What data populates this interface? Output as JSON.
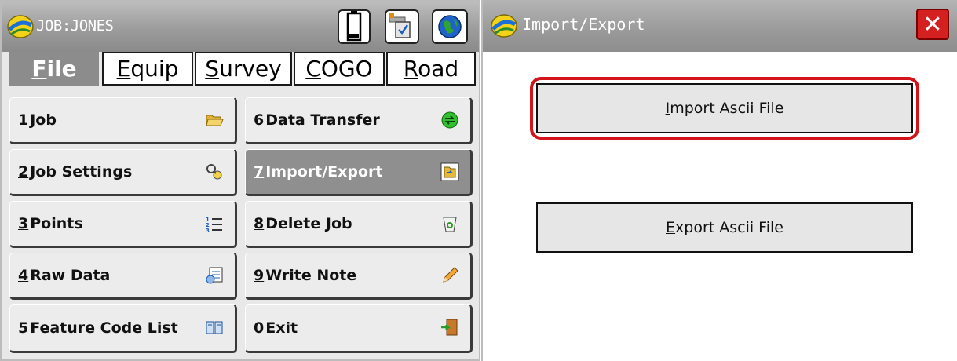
{
  "left_window": {
    "title": "JOB:JONES",
    "tabs": [
      {
        "key": "F",
        "rest": "ile",
        "active": true
      },
      {
        "key": "E",
        "rest": "quip",
        "active": false
      },
      {
        "key": "S",
        "rest": "urvey",
        "active": false
      },
      {
        "key": "C",
        "rest": "OGO",
        "active": false
      },
      {
        "key": "R",
        "rest": "oad",
        "active": false
      }
    ],
    "menu": [
      {
        "key": "1",
        "label": "Job",
        "icon": "folder-open-icon"
      },
      {
        "key": "2",
        "label": "Job Settings",
        "icon": "settings-search-icon"
      },
      {
        "key": "3",
        "label": "Points",
        "icon": "numbered-list-icon"
      },
      {
        "key": "4",
        "label": "Raw Data",
        "icon": "raw-data-icon"
      },
      {
        "key": "5",
        "label": "Feature Code List",
        "icon": "book-icon"
      },
      {
        "key": "6",
        "label": "Data Transfer",
        "icon": "transfer-icon"
      },
      {
        "key": "7",
        "label": "Import/Export",
        "icon": "import-export-icon",
        "selected": true
      },
      {
        "key": "8",
        "label": "Delete Job",
        "icon": "recycle-bin-icon"
      },
      {
        "key": "9",
        "label": "Write Note",
        "icon": "pencil-icon"
      },
      {
        "key": "0",
        "label": "Exit",
        "icon": "exit-door-icon"
      }
    ]
  },
  "right_window": {
    "title": "Import/Export",
    "close_label": "✕",
    "import": {
      "key": "I",
      "rest": "mport Ascii File"
    },
    "export": {
      "key": "E",
      "rest": "xport Ascii File"
    }
  },
  "colors": {
    "selected_bg": "#8f8f8f",
    "highlight_red": "#d3141a",
    "close_red": "#d42020"
  }
}
